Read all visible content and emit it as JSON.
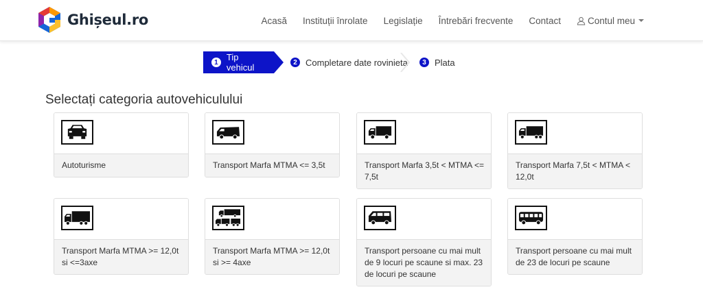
{
  "brand": {
    "name": "Ghișeul.ro"
  },
  "nav": {
    "items": [
      "Acasă",
      "Instituții înrolate",
      "Legislație",
      "Întrebări frecvente",
      "Contact"
    ],
    "account": "Contul meu"
  },
  "stepper": {
    "steps": [
      {
        "number": "1",
        "label": "Tip vehicul",
        "state": "active"
      },
      {
        "number": "2",
        "label": "Completare date rovinieta",
        "state": "pending"
      },
      {
        "number": "3",
        "label": "Plata",
        "state": "pending"
      }
    ]
  },
  "main": {
    "title": "Selectați categoria autovehiculului",
    "categories": [
      {
        "label": "Autoturisme",
        "icon": "car-icon"
      },
      {
        "label": "Transport Marfa MTMA <= 3,5t",
        "icon": "van-icon"
      },
      {
        "label": "Transport Marfa 3,5t < MTMA <= 7,5t",
        "icon": "small-truck-icon"
      },
      {
        "label": "Transport Marfa 7,5t < MTMA < 12,0t",
        "icon": "truck-icon"
      },
      {
        "label": "Transport Marfa MTMA >= 12,0t si <=3axe",
        "icon": "heavy-truck-icon"
      },
      {
        "label": "Transport Marfa MTMA >= 12,0t si >= 4axe",
        "icon": "truck-trailer-icon"
      },
      {
        "label": "Transport persoane cu mai mult de 9 locuri pe scaune si max. 23 de locuri pe scaune",
        "icon": "minibus-icon"
      },
      {
        "label": "Transport persoane cu mai mult de 23 de locuri pe scaune",
        "icon": "bus-icon"
      }
    ]
  },
  "colors": {
    "accent": "#0d14c8",
    "card_label_bg": "#f3f3f3",
    "border": "#dedede"
  }
}
